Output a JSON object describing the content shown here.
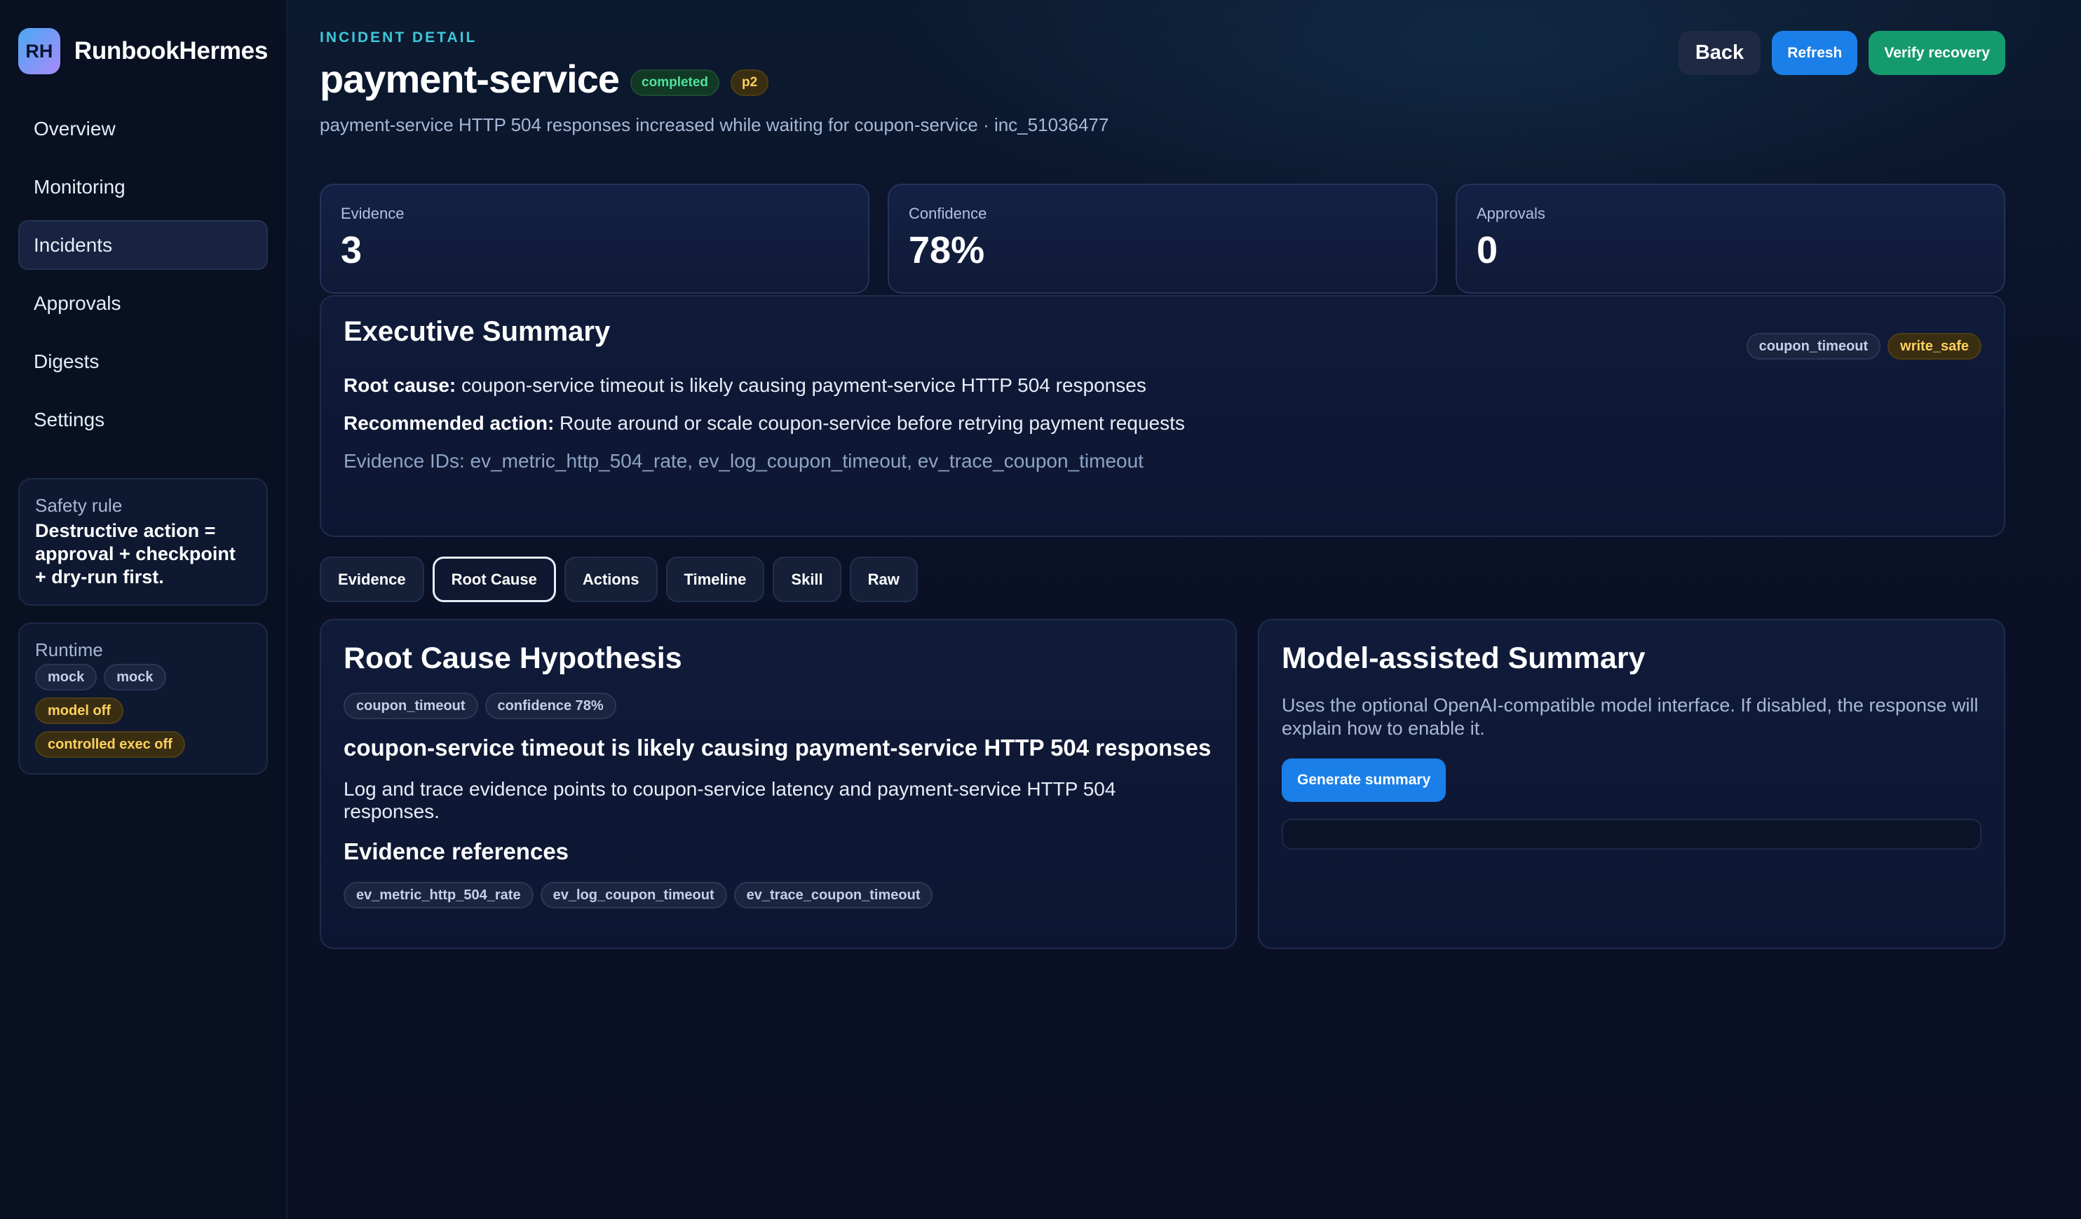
{
  "brand": {
    "initials": "RH",
    "name": "RunbookHermes"
  },
  "nav": [
    {
      "label": "Overview"
    },
    {
      "label": "Monitoring"
    },
    {
      "label": "Incidents",
      "active": true
    },
    {
      "label": "Approvals"
    },
    {
      "label": "Digests"
    },
    {
      "label": "Settings"
    }
  ],
  "safety": {
    "title": "Safety rule",
    "body": "Destructive action = approval + checkpoint + dry-run first."
  },
  "runtime": {
    "title": "Runtime",
    "chips": [
      "mock",
      "mock",
      "model off",
      "controlled exec off"
    ]
  },
  "header": {
    "eyebrow": "INCIDENT DETAIL",
    "title": "payment-service",
    "status_badge": "completed",
    "priority_badge": "p2",
    "subtitle": "payment-service HTTP 504 responses increased while waiting for coupon-service · inc_51036477",
    "back_label": "Back",
    "refresh_label": "Refresh",
    "verify_label": "Verify recovery"
  },
  "stats": {
    "evidence_label": "Evidence",
    "evidence_value": "3",
    "confidence_label": "Confidence",
    "confidence_value": "78%",
    "approvals_label": "Approvals",
    "approvals_value": "0"
  },
  "summary": {
    "title": "Executive Summary",
    "tags": [
      "coupon_timeout",
      "write_safe"
    ],
    "root_cause_label": "Root cause:",
    "root_cause_text": " coupon-service timeout is likely causing payment-service HTTP 504 responses",
    "action_label": "Recommended action:",
    "action_text": " Route around or scale coupon-service before retrying payment requests",
    "evidence_ids": "Evidence IDs: ev_metric_http_504_rate, ev_log_coupon_timeout, ev_trace_coupon_timeout"
  },
  "tabs": [
    {
      "label": "Evidence"
    },
    {
      "label": "Root Cause",
      "active": true
    },
    {
      "label": "Actions"
    },
    {
      "label": "Timeline"
    },
    {
      "label": "Skill"
    },
    {
      "label": "Raw"
    }
  ],
  "root_cause": {
    "title": "Root Cause Hypothesis",
    "tags": [
      "coupon_timeout",
      "confidence 78%"
    ],
    "headline": "coupon-service timeout is likely causing payment-service HTTP 504 responses",
    "body": "Log and trace evidence points to coupon-service latency and payment-service HTTP 504 responses.",
    "refs_title": "Evidence references",
    "refs": [
      "ev_metric_http_504_rate",
      "ev_log_coupon_timeout",
      "ev_trace_coupon_timeout"
    ]
  },
  "model_summary": {
    "title": "Model-assisted Summary",
    "body": "Uses the optional OpenAI-compatible model interface. If disabled, the response will explain how to enable it.",
    "button_label": "Generate summary"
  },
  "colors": {
    "accent": "#1a7fe8",
    "success": "#159a6e",
    "eyebrow": "#3fc7d9",
    "warn": "#ffd15c"
  }
}
